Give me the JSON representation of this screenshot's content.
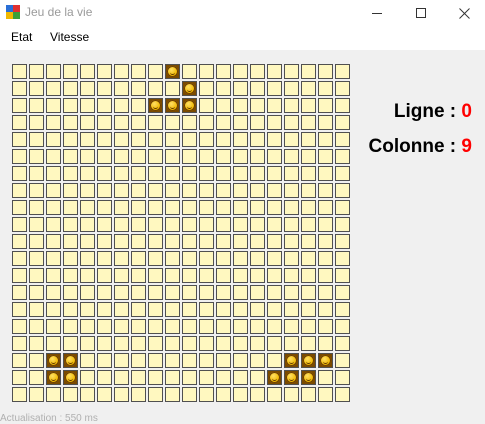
{
  "window": {
    "title": "Jeu de la vie",
    "buttons": [
      "minimize",
      "maximize",
      "close"
    ]
  },
  "menu": {
    "items": [
      "Etat",
      "Vitesse"
    ]
  },
  "board": {
    "rows": 20,
    "cols": 20,
    "alive_cells": [
      [
        0,
        9
      ],
      [
        1,
        10
      ],
      [
        2,
        8
      ],
      [
        2,
        9
      ],
      [
        2,
        10
      ],
      [
        17,
        2
      ],
      [
        17,
        3
      ],
      [
        17,
        16
      ],
      [
        17,
        17
      ],
      [
        17,
        18
      ],
      [
        18,
        2
      ],
      [
        18,
        3
      ],
      [
        18,
        15
      ],
      [
        18,
        16
      ],
      [
        18,
        17
      ]
    ],
    "colors": {
      "dead": "#fff8c0",
      "alive": "#f0b800",
      "border": "#505050"
    }
  },
  "info": {
    "row_label": "Ligne :",
    "row_value": "0",
    "col_label": "Colonne :",
    "col_value": "9",
    "value_color": "#ff0000"
  },
  "status": {
    "text": "Actualisation : 550 ms"
  }
}
